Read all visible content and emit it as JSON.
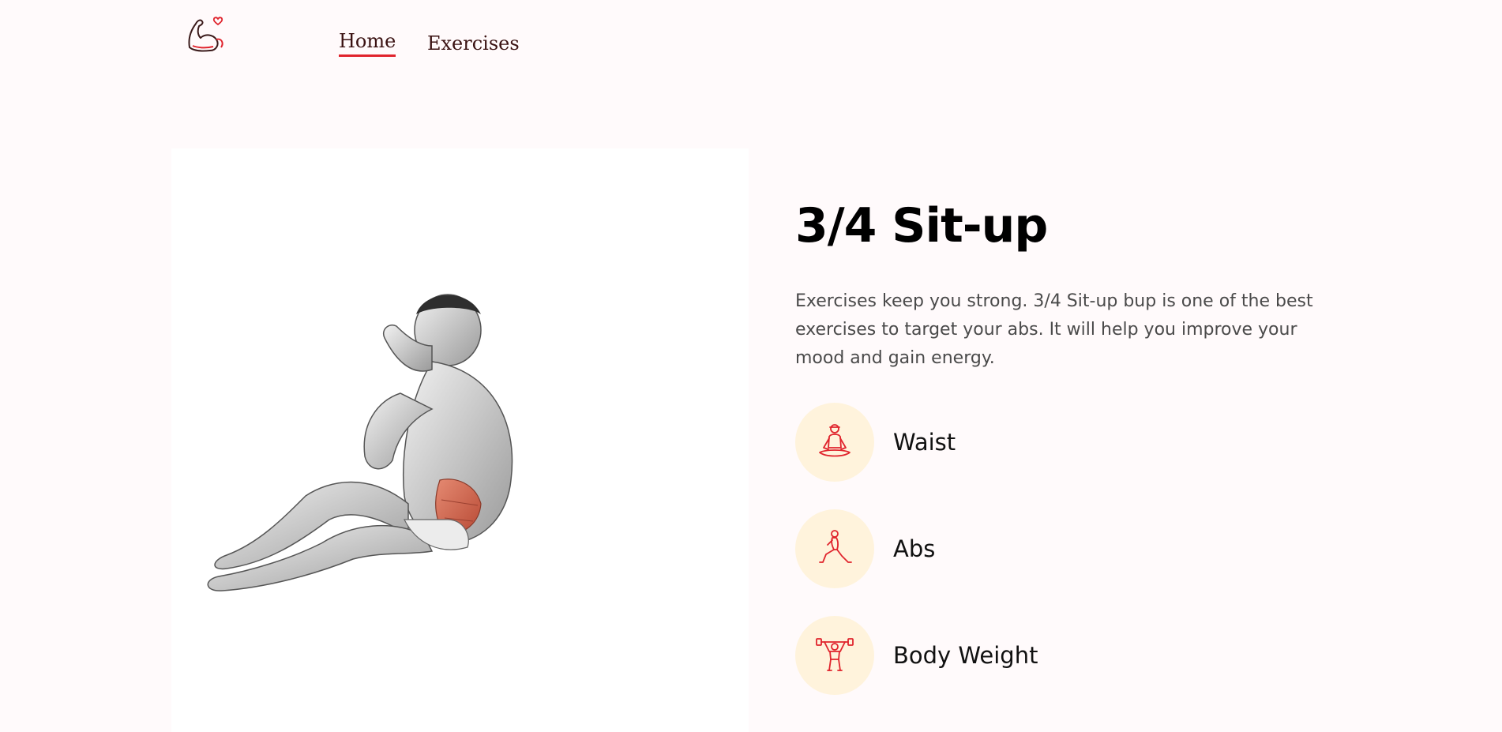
{
  "nav": {
    "logo_icon": "flexed-arm-heart-icon",
    "home_label": "Home",
    "exercises_label": "Exercises"
  },
  "exercise": {
    "image_icon": "situp-muscle-figure",
    "title": "3/4 Sit-up",
    "description": "Exercises keep you strong. 3/4 Sit-up bup is one of the best exercises to target your abs. It will help you improve your mood and gain energy.",
    "tags": [
      {
        "icon": "meditation-icon",
        "label": "Waist"
      },
      {
        "icon": "lunge-icon",
        "label": "Abs"
      },
      {
        "icon": "weightlifter-icon",
        "label": "Body Weight"
      }
    ]
  },
  "colors": {
    "accent": "#e0242d",
    "background": "#fffafb",
    "tag_circle": "#fff3dc",
    "muscle_highlight": "#d9614a"
  }
}
